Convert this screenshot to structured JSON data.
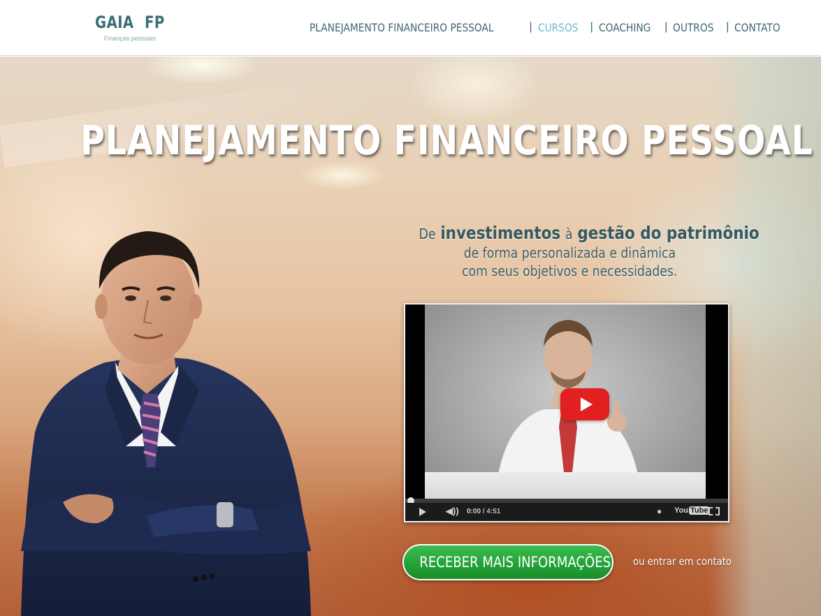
{
  "logo": {
    "title": "GAIA  FP",
    "subtitle": "Finanças pessoais"
  },
  "nav": {
    "items": [
      {
        "label": "PLANEJAMENTO FINANCEIRO PESSOAL",
        "active": false
      },
      {
        "label": "CURSOS",
        "active": true
      },
      {
        "label": "COACHING",
        "active": false
      },
      {
        "label": "OUTROS",
        "active": false
      },
      {
        "label": "CONTATO",
        "active": false
      }
    ],
    "separator": "|"
  },
  "hero": {
    "title": "PLANEJAMENTO FINANCEIRO PESSOAL",
    "tagline": {
      "de": "De",
      "investimentos": "investimentos",
      "a": "à",
      "gestao": "gestão do patrimônio",
      "line2": "de forma personalizada e dinâmica",
      "line3": "com seus objetivos e necessidades."
    }
  },
  "video": {
    "current_time": "0:00",
    "total_time": " / 4:51",
    "youtube_label": "You",
    "youtube_tube": "Tube"
  },
  "cta": {
    "button_label": "RECEBER MAIS INFORMAÇÕES",
    "contact_link": "ou entrar em contato"
  },
  "colors": {
    "nav_text": "#3f6670",
    "nav_active": "#66bccb",
    "logo": "#3a6f78",
    "cta_green": "#22a036",
    "youtube_red": "#e1201f"
  }
}
